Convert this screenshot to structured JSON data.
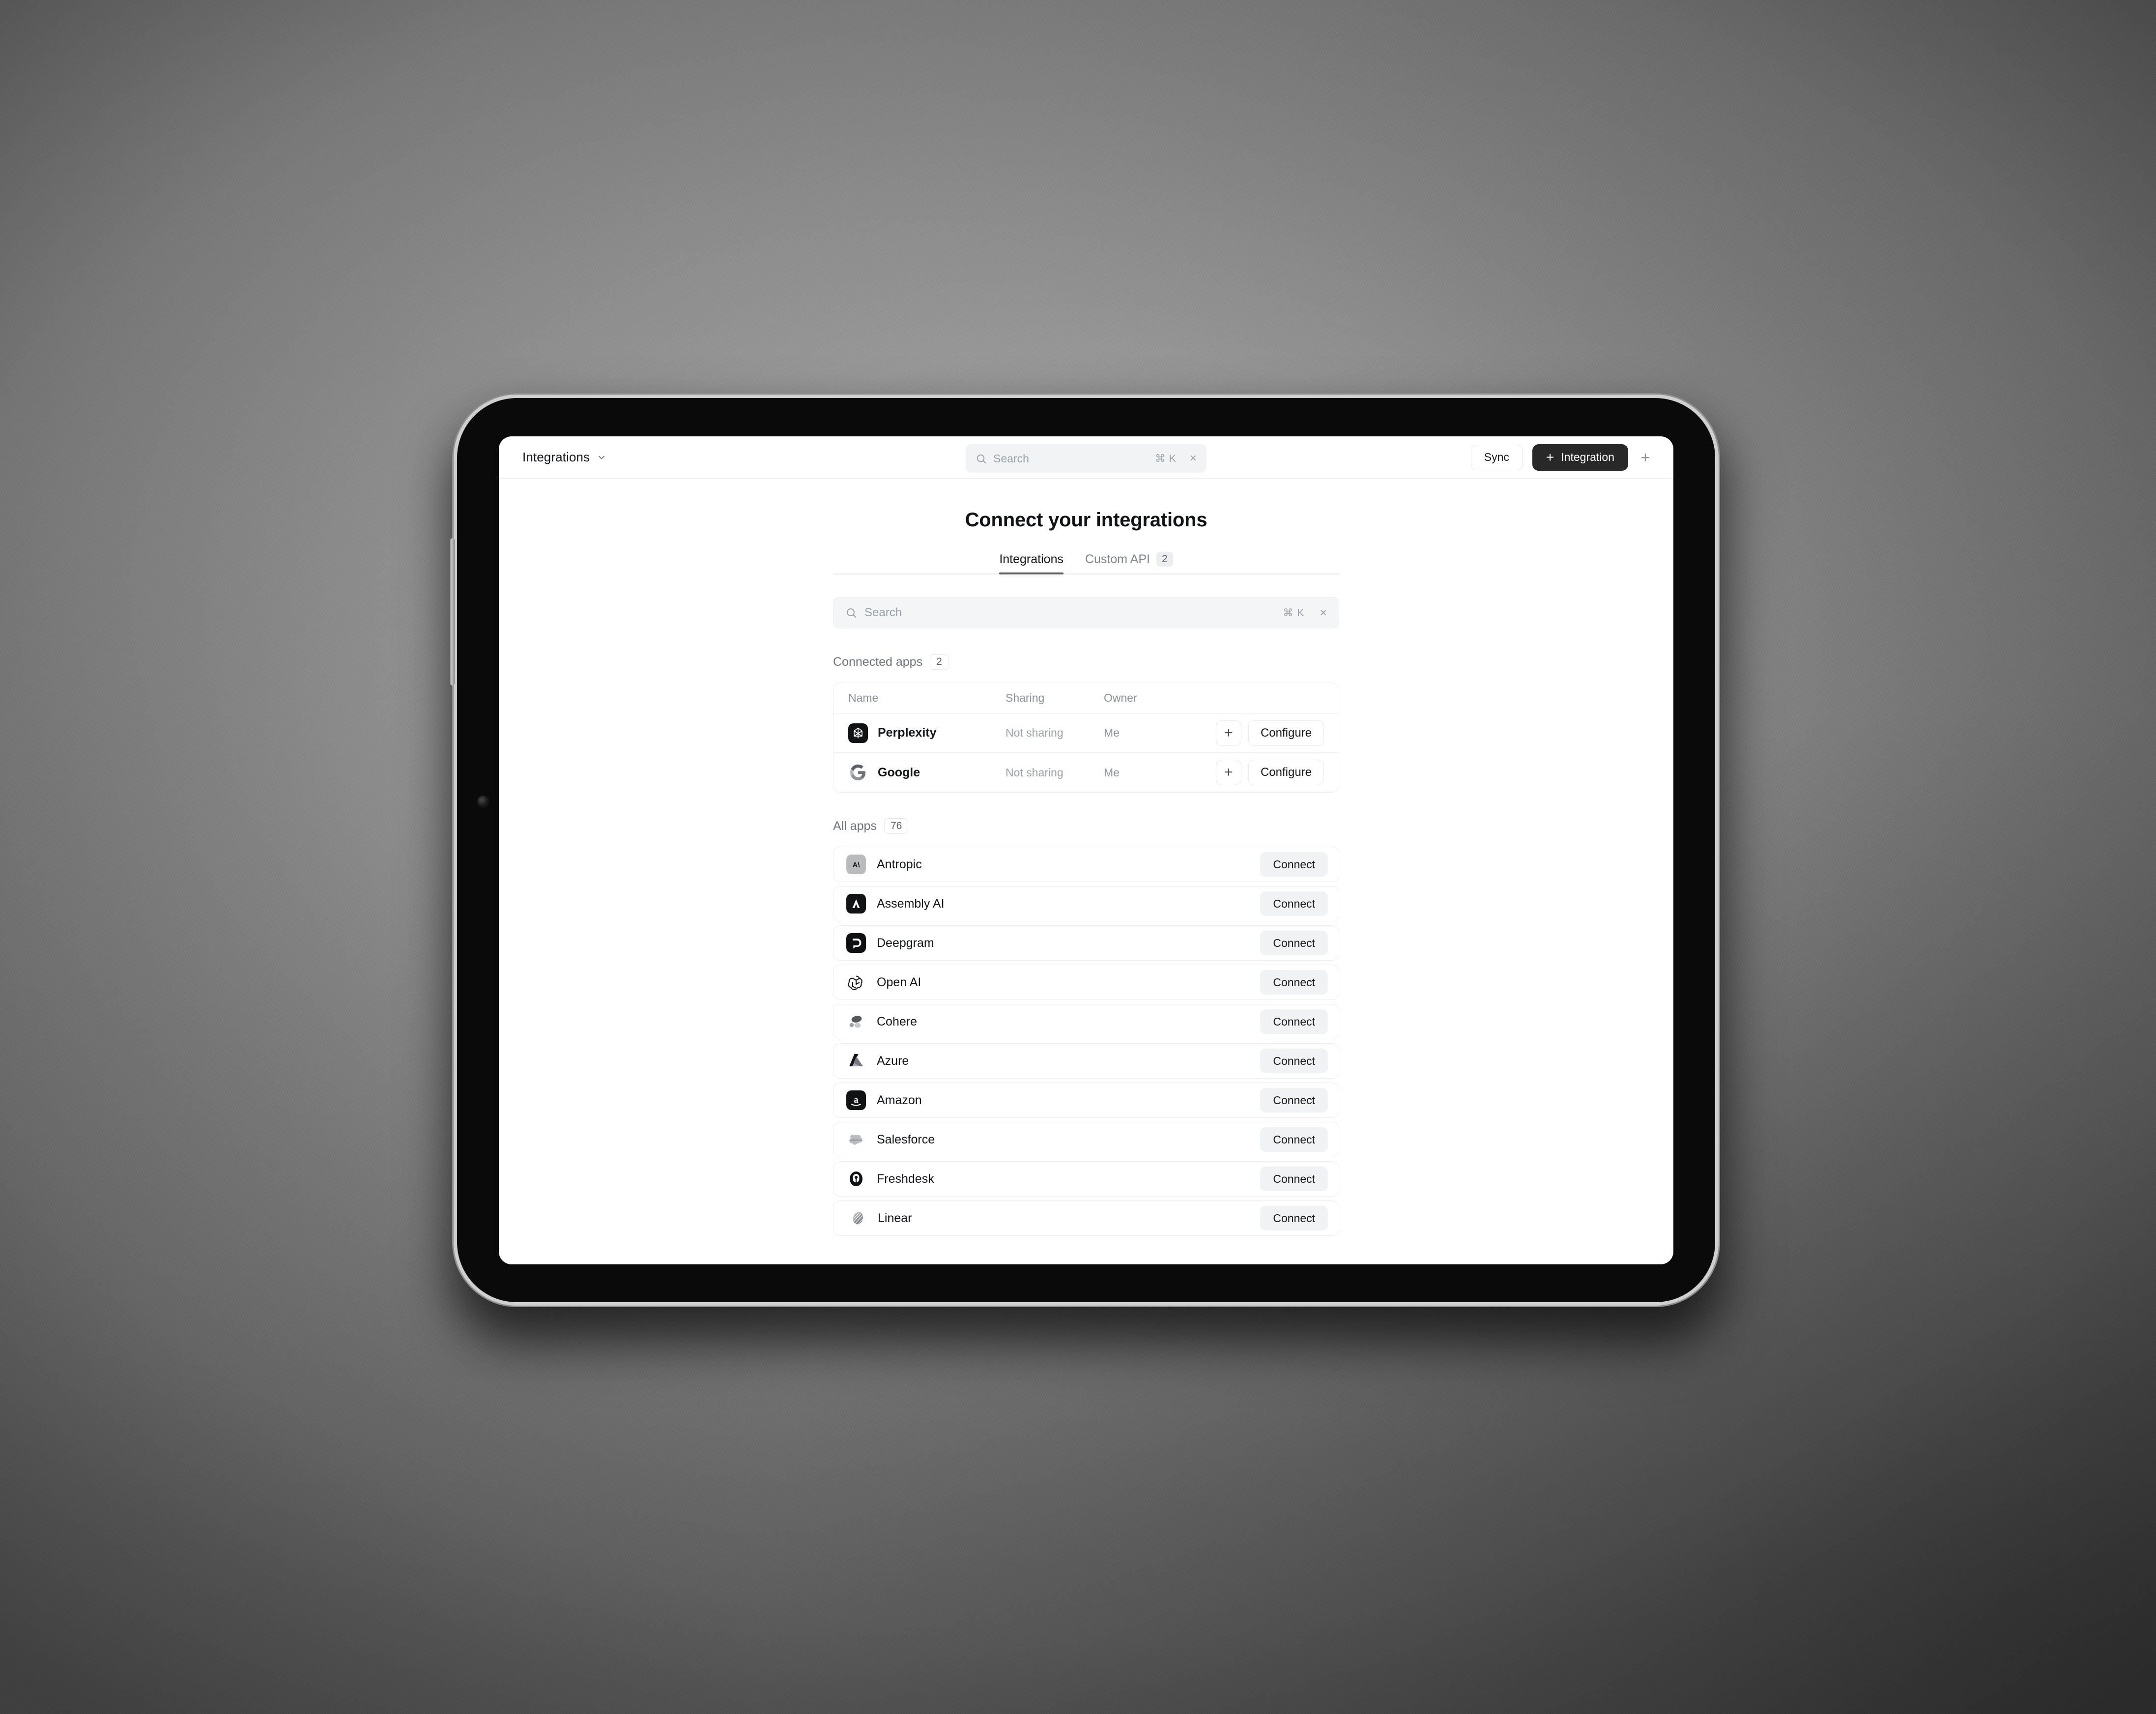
{
  "topbar": {
    "breadcrumb_label": "Integrations",
    "breadcrumb_chevron_icon": "chevron-down-icon",
    "search": {
      "icon": "search-icon",
      "placeholder": "Search",
      "value": "",
      "shortcut": "⌘ K",
      "clear_icon": "×"
    },
    "sync_label": "Sync",
    "add_integration_label": "Integration",
    "add_integration_plus": "+",
    "add_plain_plus": "+"
  },
  "main": {
    "page_title": "Connect your integrations",
    "tabs": [
      {
        "label": "Integrations",
        "count": "",
        "active": true
      },
      {
        "label": "Custom API",
        "count": "2",
        "active": false
      }
    ],
    "search": {
      "icon": "search-icon",
      "placeholder": "Search",
      "value": "",
      "shortcut": "⌘ K",
      "clear_icon": "×"
    },
    "connected": {
      "label": "Connected apps",
      "count": "2",
      "columns": [
        "Name",
        "Sharing",
        "Owner"
      ],
      "add_icon": "plus-icon",
      "configure_label": "Configure",
      "rows": [
        {
          "name": "Perplexity",
          "icon": "perplexity-logo",
          "sharing": "Not sharing",
          "owner": "Me"
        },
        {
          "name": "Google",
          "icon": "google-logo",
          "sharing": "Not sharing",
          "owner": "Me"
        }
      ]
    },
    "all_apps": {
      "label": "All apps",
      "count": "76",
      "connect_label": "Connect",
      "rows": [
        {
          "name": "Antropic",
          "icon": "anthropic-logo"
        },
        {
          "name": "Assembly AI",
          "icon": "assemblyai-logo"
        },
        {
          "name": "Deepgram",
          "icon": "deepgram-logo"
        },
        {
          "name": "Open AI",
          "icon": "openai-logo"
        },
        {
          "name": "Cohere",
          "icon": "cohere-logo"
        },
        {
          "name": "Azure",
          "icon": "azure-logo"
        },
        {
          "name": "Amazon",
          "icon": "amazon-logo"
        },
        {
          "name": "Salesforce",
          "icon": "salesforce-logo"
        },
        {
          "name": "Freshdesk",
          "icon": "freshdesk-logo"
        },
        {
          "name": "Linear",
          "icon": "linear-logo"
        }
      ]
    }
  },
  "colors": {
    "accent_dark": "#282828",
    "surface": "#ffffff",
    "muted_bg": "#f2f3f4",
    "text": "#14161a",
    "text_muted": "#8b9096",
    "border": "#ededee"
  }
}
